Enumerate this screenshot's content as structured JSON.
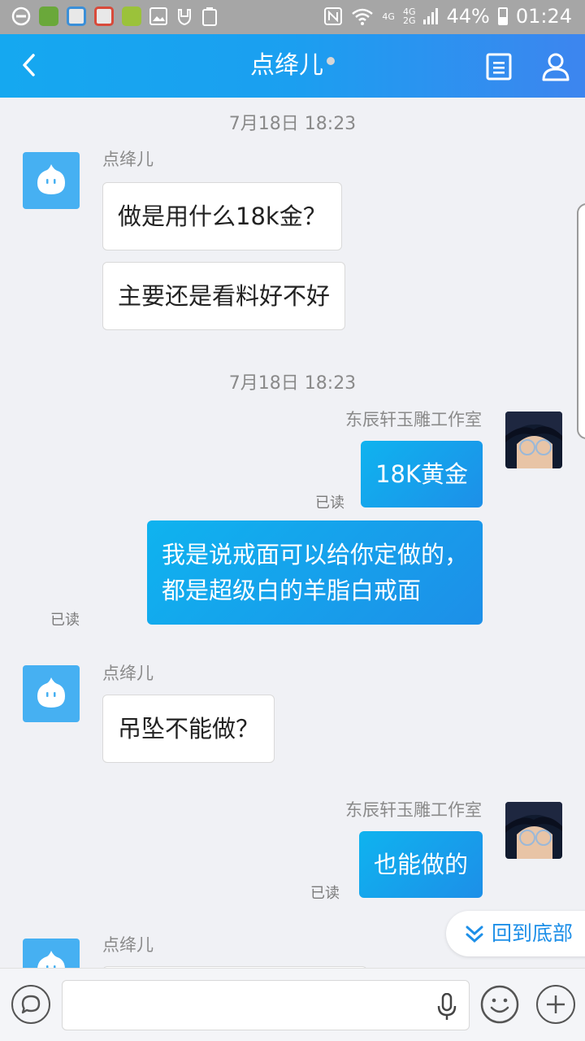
{
  "status_bar": {
    "network_top": "4G",
    "network_dual_a": "4G",
    "network_dual_b": "2G",
    "battery": "44%",
    "time": "01:24",
    "nfc_icon": "nfc-icon",
    "wifi_icon": "wifi-icon"
  },
  "header": {
    "title": "点绛儿",
    "back_icon": "chevron-left-icon",
    "profile_doc_icon": "document-icon",
    "profile_icon": "person-icon"
  },
  "messages": {
    "ts1": "7月18日 18:23",
    "ts2": "7月18日 18:23",
    "in_name1": "点绛儿",
    "in_msg1": "做是用什么18k金？",
    "in_msg2": "主要还是看料好不好",
    "out_name1": "东辰轩玉雕工作室",
    "out_msg1": "18K黄金",
    "out_read1": "已读",
    "out_msg2_line1": "我是说戒面可以给你定做的，",
    "out_msg2_line2": "都是超级白的羊脂白戒面",
    "out_read2": "已读",
    "in_name2": "点绛儿",
    "in_msg3": "吊坠不能做？",
    "out_name2": "东辰轩玉雕工作室",
    "out_msg3": "也能做的",
    "out_read3": "已读",
    "in_name3": "点绛儿"
  },
  "back_to_bottom": "回到底部",
  "input": {
    "value": ""
  },
  "colors": {
    "header_start": "#15a8f0",
    "header_end": "#3d85ef",
    "out_bubble": "#1d8fe8",
    "accent": "#1d8fe8"
  }
}
